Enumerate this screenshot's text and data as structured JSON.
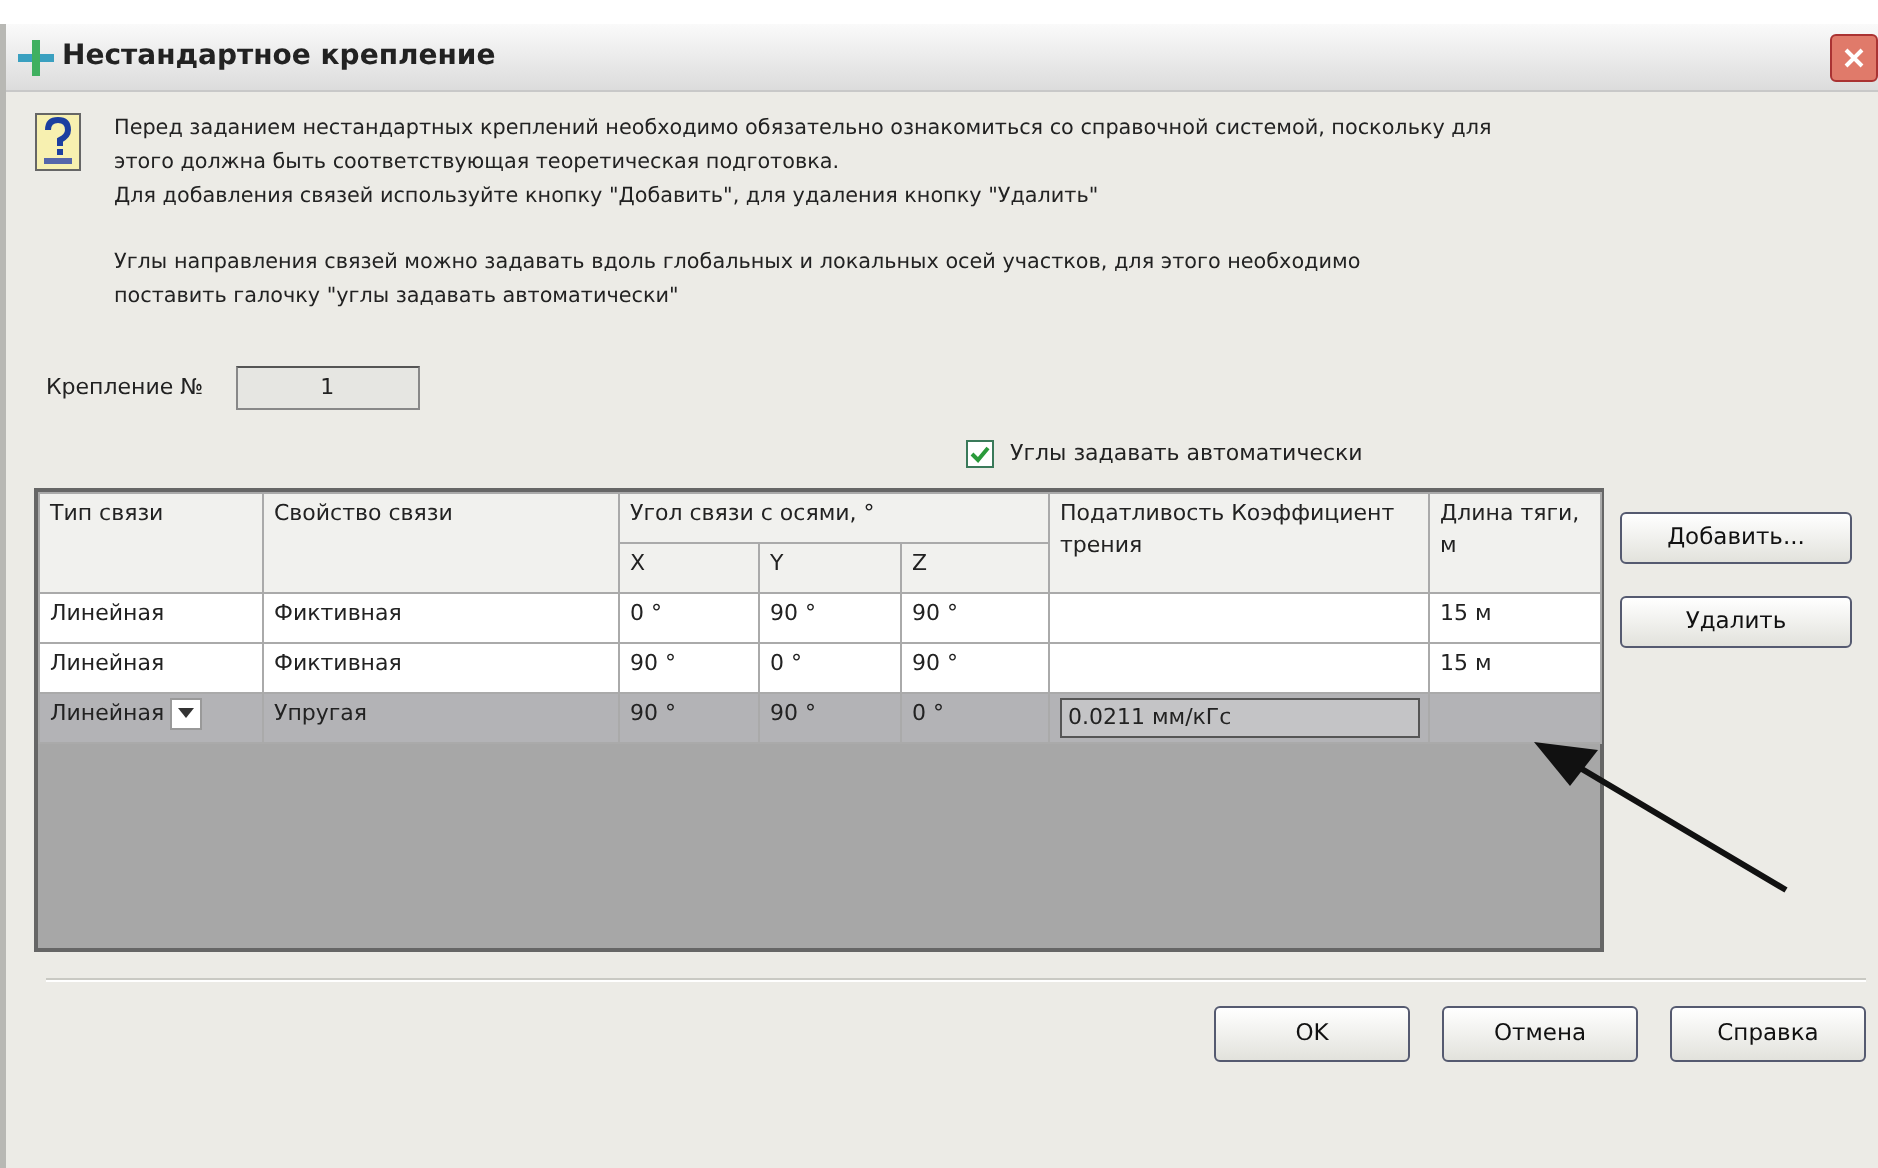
{
  "window": {
    "title": "Нестандартное крепление"
  },
  "info": [
    "Перед заданием нестандартных креплений необходимо обязательно ознакомиться со справочной системой, поскольку для этого должна быть соответствующая теоретическая подготовка.",
    "Для добавления связей используйте кнопку \"Добавить\", для удаления кнопку \"Удалить\"",
    "Углы направления связей можно задавать вдоль глобальных и локальных осей участков, для этого необходимо поставить галочку \"углы задавать автоматически\""
  ],
  "fastening": {
    "label": "Крепление №",
    "value": "1"
  },
  "auto_angles": {
    "label": "Углы задавать автоматически",
    "checked": true
  },
  "table": {
    "columns": {
      "type": "Тип связи",
      "property": "Свойство связи",
      "angle": "Угол связи с осями, °",
      "x": "X",
      "y": "Y",
      "z": "Z",
      "compliance": "Податливость Коэффициент трения",
      "length": "Длина тяги, м"
    },
    "rows": [
      {
        "type": "Линейная",
        "property": "Фиктивная",
        "x": "0 °",
        "y": "90 °",
        "z": "90 °",
        "compliance": "",
        "length": "15 м",
        "selected": false
      },
      {
        "type": "Линейная",
        "property": "Фиктивная",
        "x": "90 °",
        "y": "0 °",
        "z": "90 °",
        "compliance": "",
        "length": "15 м",
        "selected": false
      },
      {
        "type": "Линейная",
        "property": "Упругая",
        "x": "90 °",
        "y": "90 °",
        "z": "0 °",
        "compliance": "0.0211 мм/кГс",
        "length": "",
        "selected": true
      }
    ]
  },
  "side_buttons": [
    "Добавить...",
    "Удалить"
  ],
  "buttons": [
    "OK",
    "Отмена",
    "Справка"
  ]
}
